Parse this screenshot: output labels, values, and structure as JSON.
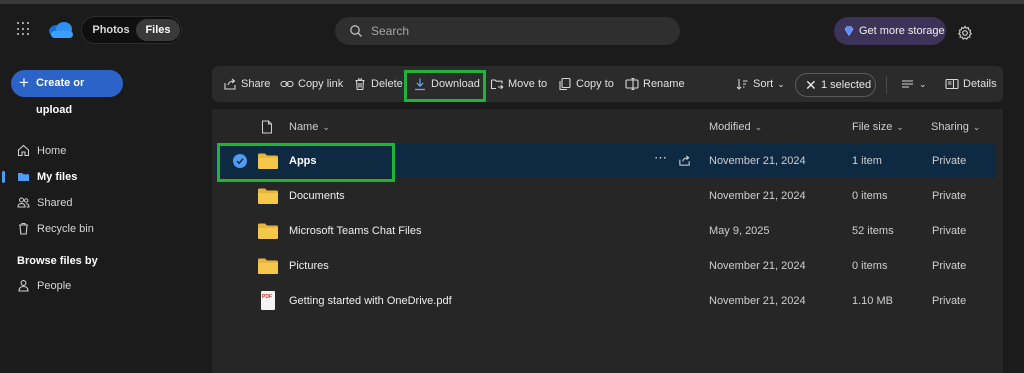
{
  "header": {
    "switcher": {
      "photos_label": "Photos",
      "files_label": "Files"
    },
    "search": {
      "placeholder": "Search"
    },
    "storage_label": "Get more storage"
  },
  "sidebar": {
    "create_label": "Create or upload",
    "nav": [
      {
        "label": "Home",
        "icon": "home-icon"
      },
      {
        "label": "My files",
        "icon": "folder-icon",
        "active": true
      },
      {
        "label": "Shared",
        "icon": "people-icon"
      },
      {
        "label": "Recycle bin",
        "icon": "trash-icon"
      }
    ],
    "browse_title": "Browse files by",
    "browse": [
      {
        "label": "People",
        "icon": "person-icon"
      }
    ]
  },
  "toolbar": {
    "share": "Share",
    "copy_link": "Copy link",
    "delete": "Delete",
    "download": "Download",
    "move_to": "Move to",
    "copy_to": "Copy to",
    "rename": "Rename",
    "sort": "Sort",
    "selected": "1 selected",
    "details": "Details"
  },
  "table": {
    "columns": {
      "name": "Name",
      "modified": "Modified",
      "size": "File size",
      "sharing": "Sharing"
    },
    "rows": [
      {
        "name": "Apps",
        "modified": "November 21, 2024",
        "size": "1 item",
        "sharing": "Private",
        "type": "folder",
        "selected": true
      },
      {
        "name": "Documents",
        "modified": "November 21, 2024",
        "size": "0 items",
        "sharing": "Private",
        "type": "folder"
      },
      {
        "name": "Microsoft Teams Chat Files",
        "modified": "May 9, 2025",
        "size": "52 items",
        "sharing": "Private",
        "type": "folder"
      },
      {
        "name": "Pictures",
        "modified": "November 21, 2024",
        "size": "0 items",
        "sharing": "Private",
        "type": "folder"
      },
      {
        "name": "Getting started with OneDrive.pdf",
        "modified": "November 21, 2024",
        "size": "1.10 MB",
        "sharing": "Private",
        "type": "pdf"
      }
    ]
  },
  "colors": {
    "accent": "#2b63c9",
    "highlight": "#1eb43a",
    "selected_row": "#0e2942",
    "folder": "#f0c040"
  }
}
